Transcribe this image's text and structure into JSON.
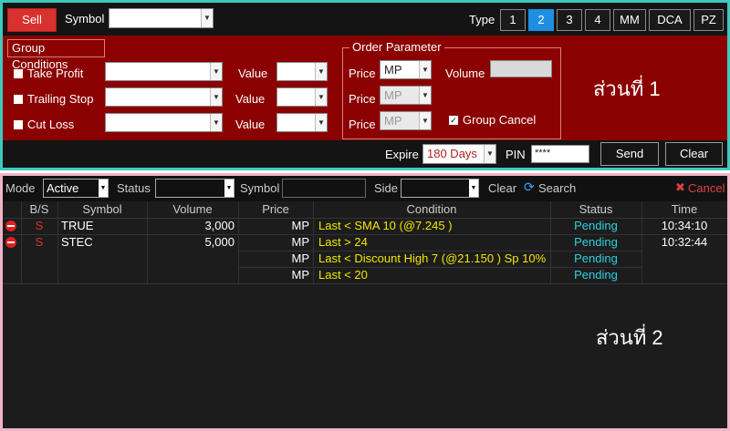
{
  "top": {
    "sell_label": "Sell",
    "symbol_label": "Symbol",
    "symbol_value": "",
    "type_label": "Type",
    "type_buttons": [
      "1",
      "2",
      "3",
      "4",
      "MM",
      "DCA",
      "PZ"
    ],
    "type_active": "2"
  },
  "group": {
    "title": "Group Conditions",
    "rows": [
      {
        "label": "Take Profit",
        "value_label": "Value"
      },
      {
        "label": "Trailing Stop",
        "value_label": "Value"
      },
      {
        "label": "Cut Loss",
        "value_label": "Value"
      }
    ]
  },
  "order": {
    "title": "Order Parameter",
    "price_label": "Price",
    "price_values": [
      "MP",
      "MP",
      "MP"
    ],
    "volume_label": "Volume",
    "volume_value": "",
    "group_cancel_label": "Group Cancel",
    "group_cancel_checked": true
  },
  "bottom": {
    "expire_label": "Expire",
    "expire_value": "180 Days",
    "pin_label": "PIN",
    "pin_value": "****",
    "send_label": "Send",
    "clear_label": "Clear"
  },
  "annotations": {
    "part1": "ส่วนที่ 1",
    "part2": "ส่วนที่ 2"
  },
  "filter": {
    "mode_label": "Mode",
    "mode_value": "Active",
    "status_label": "Status",
    "status_value": "",
    "symbol_label": "Symbol",
    "side_label": "Side",
    "clear_label": "Clear",
    "search_label": "Search",
    "cancel_label": "Cancel"
  },
  "table": {
    "headers": [
      "B/S",
      "Symbol",
      "Volume",
      "Price",
      "Condition",
      "Status",
      "Time"
    ],
    "rows": [
      {
        "side": "S",
        "symbol": "TRUE",
        "volume": "3,000",
        "price": "MP",
        "condition": "Last < SMA 10 (@7.245 )",
        "status": "Pending",
        "time": "10:34:10"
      },
      {
        "side": "S",
        "symbol": "STEC",
        "volume": "5,000",
        "price": "MP",
        "condition": "Last > 24",
        "status": "Pending",
        "time": "10:32:44"
      },
      {
        "side": "",
        "symbol": "",
        "volume": "",
        "price": "MP",
        "condition": "Last < Discount High 7 (@21.150 ) Sp 10%",
        "status": "Pending",
        "time": ""
      },
      {
        "side": "",
        "symbol": "",
        "volume": "",
        "price": "MP",
        "condition": "Last < 20",
        "status": "Pending",
        "time": ""
      }
    ]
  },
  "colors": {
    "panel_red": "#8b0000",
    "section1_border": "#3fc9bd",
    "section2_border": "#f0b4c8",
    "sell_red": "#d9312f",
    "active_blue": "#1e8fe0",
    "condition_yellow": "#f2e600",
    "status_cyan": "#2fd0e0"
  }
}
